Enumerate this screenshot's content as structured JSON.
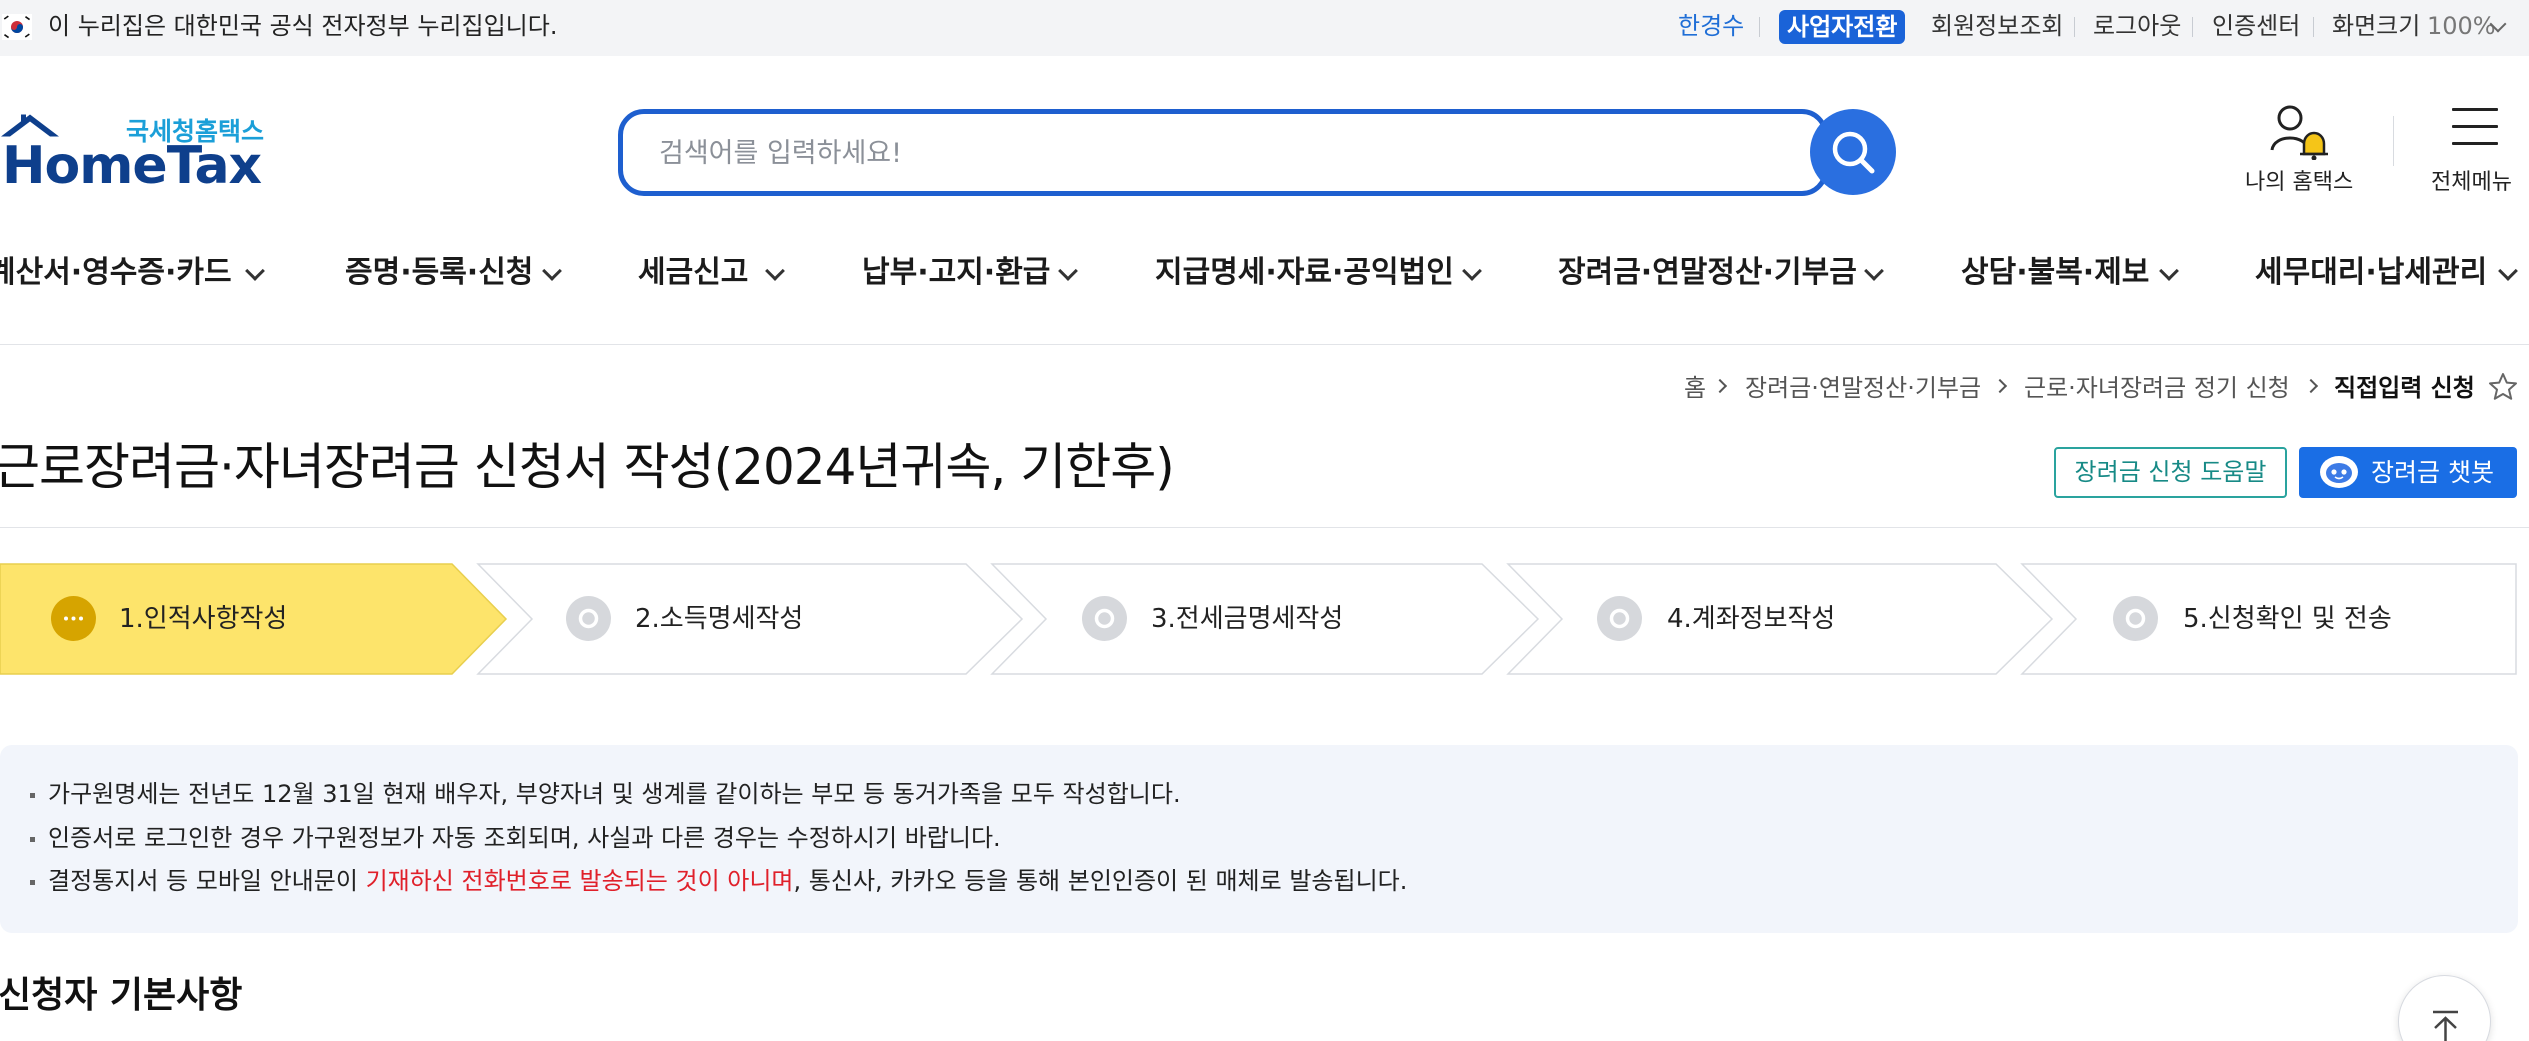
{
  "govbar": {
    "notice": "이 누리집은 대한민국 공식 전자정부 누리집입니다.",
    "user_name": "한경수",
    "switch_label": "사업자전환",
    "member_info": "회원정보조회",
    "logout": "로그아웃",
    "cert_center": "인증센터",
    "screen_size": "화면크기",
    "zoom": "100%"
  },
  "header": {
    "logo_sub": "국세청홈택스",
    "logo_main": "HomeTax",
    "search_placeholder": "검색어를 입력하세요!",
    "my_hometax": "나의 홈택스",
    "all_menu": "전체메뉴"
  },
  "gnb": [
    {
      "label": "계산서·영수증·카드"
    },
    {
      "label": "증명·등록·신청"
    },
    {
      "label": "세금신고"
    },
    {
      "label": "납부·고지·환급"
    },
    {
      "label": "지급명세·자료·공익법인"
    },
    {
      "label": "장려금·연말정산·기부금"
    },
    {
      "label": "상담·불복·제보"
    },
    {
      "label": "세무대리·납세관리"
    }
  ],
  "breadcrumb": [
    "홈",
    "장려금·연말정산·기부금",
    "근로·자녀장려금 정기 신청",
    "직접입력 신청"
  ],
  "page": {
    "title": "근로장려금·자녀장려금 신청서 작성(2024년귀속, 기한후)",
    "help_button": "장려금 신청 도움말",
    "chatbot_button": "장려금 챗봇"
  },
  "steps": [
    {
      "label": "1.인적사항작성",
      "active": true
    },
    {
      "label": "2.소득명세작성",
      "active": false
    },
    {
      "label": "3.전세금명세작성",
      "active": false
    },
    {
      "label": "4.계좌정보작성",
      "active": false
    },
    {
      "label": "5.신청확인 및 전송",
      "active": false
    }
  ],
  "notices": {
    "line1": "가구원명세는 전년도 12월 31일 현재 배우자, 부양자녀 및 생계를 같이하는 부모 등 동거가족을 모두 작성합니다.",
    "line2": "인증서로 로그인한 경우 가구원정보가 자동 조회되며, 사실과 다른 경우는 수정하시기 바랍니다.",
    "line3_a": "결정통지서 등 모바일 안내문이 ",
    "line3_red": "기재하신 전화번호로 발송되는 것이 아니며",
    "line3_b": ", 통신사, 카카오 등을 통해 본인인증이 된 매체로 발송됩니다."
  },
  "section": {
    "title": "신청자 기본사항"
  },
  "colors": {
    "primary": "#1a6ee5",
    "active_step": "#fde46b",
    "notice_bg": "#f2f5fb",
    "logo_blue": "#0e3f8c"
  }
}
